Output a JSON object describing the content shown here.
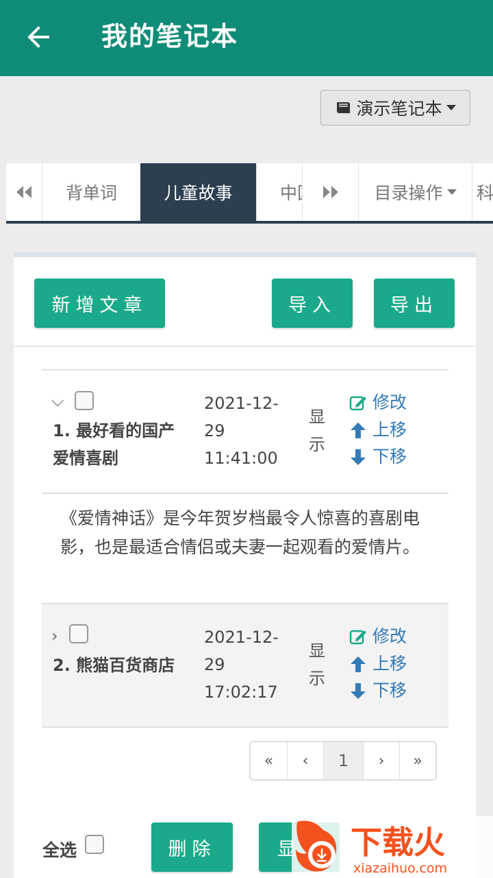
{
  "app_bar": {
    "title": "我的笔记本"
  },
  "notebook_select": {
    "label": "演示笔记本"
  },
  "tabs": [
    {
      "label": "背单词"
    },
    {
      "label": "儿童故事"
    },
    {
      "label": "中国"
    },
    {
      "label": "目录操作"
    },
    {
      "label": "科"
    }
  ],
  "toolbar": {
    "new_article": "新增文章",
    "import": "导入",
    "export": "导出"
  },
  "articles": [
    {
      "title": "1. 最好看的国产爱情喜剧",
      "date": "2021-12-29 11:41:00",
      "status": "显示",
      "actions": {
        "edit": "修改",
        "up": "上移",
        "down": "下移"
      },
      "summary": "《爱情神话》是今年贺岁档最令人惊喜的喜剧电影，也是最适合情侣或夫妻一起观看的爱情片。"
    },
    {
      "title": "2. 熊猫百货商店",
      "date": "2021-12-29 17:02:17",
      "status": "显示",
      "actions": {
        "edit": "修改",
        "up": "上移",
        "down": "下移"
      }
    }
  ],
  "pagination": {
    "first": "«",
    "prev": "‹",
    "current": "1",
    "next": "›",
    "last": "»"
  },
  "bottom": {
    "select_all": "全选",
    "delete": "删除",
    "show": "显示"
  },
  "watermark": {
    "brand": "下载火",
    "url": "xiazaihuo.com"
  },
  "colors": {
    "primary": "#0f8c77",
    "button": "#1aaa89",
    "tab_active": "#2c3e50",
    "link": "#337ab7"
  }
}
